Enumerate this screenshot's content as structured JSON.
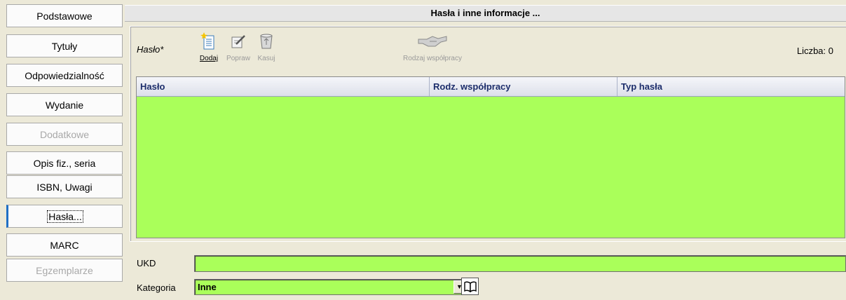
{
  "nav": {
    "items": [
      {
        "label": "Podstawowe",
        "state": "normal"
      },
      {
        "label": "Tytuły",
        "state": "normal"
      },
      {
        "label": "Odpowiedzialność",
        "state": "normal"
      },
      {
        "label": "Wydanie",
        "state": "normal"
      },
      {
        "label": "Dodatkowe",
        "state": "disabled"
      },
      {
        "label": "Opis fiz., seria",
        "state": "normal"
      },
      {
        "label": "ISBN, Uwagi",
        "state": "normal"
      },
      {
        "label": "Hasła...",
        "state": "active"
      },
      {
        "label": "MARC",
        "state": "normal"
      },
      {
        "label": "Egzemplarze",
        "state": "disabled"
      }
    ]
  },
  "panel": {
    "title": "Hasła i inne informacje ...",
    "field_label": "Hasło*",
    "count_label": "Liczba: 0",
    "toolbar": {
      "add": "Dodaj",
      "edit": "Popraw",
      "delete": "Kasuj",
      "cooperation": "Rodzaj współpracy"
    },
    "table": {
      "columns": [
        "Hasło",
        "Rodz. współpracy",
        "Typ hasła"
      ],
      "rows": []
    }
  },
  "form": {
    "ukd_label": "UKD",
    "ukd_value": "",
    "category_label": "Kategoria",
    "category_value": "Inne"
  },
  "colors": {
    "field_bg": "#aaff5a",
    "header_text": "#1c2d6b",
    "active_tab": "#1f6fc5"
  }
}
